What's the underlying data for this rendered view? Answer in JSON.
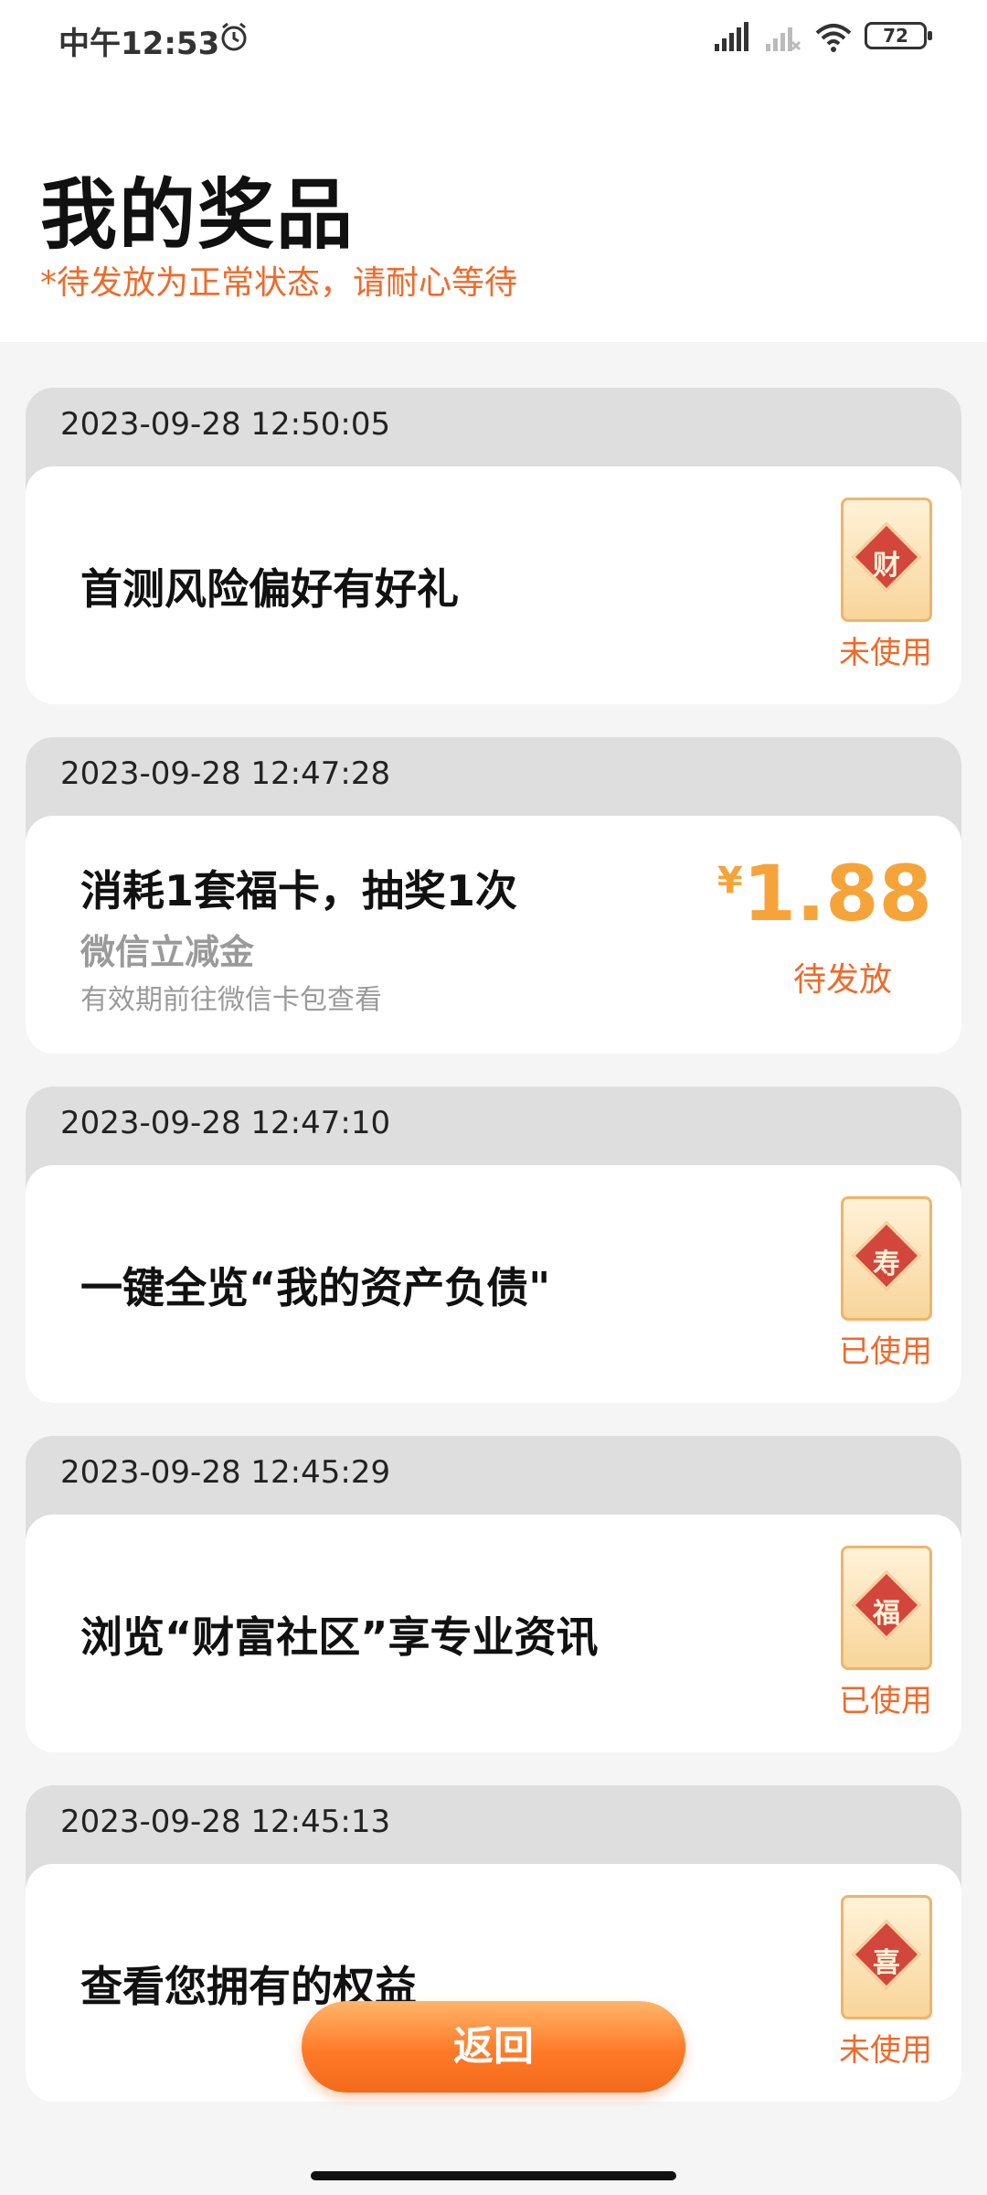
{
  "status_bar": {
    "time": "中午12:53",
    "battery": "72"
  },
  "header": {
    "title": "我的奖品",
    "subtitle": "*待发放为正常状态，请耐心等待"
  },
  "prizes": [
    {
      "time": "2023-09-28 12:50:05",
      "title": "首测风险偏好有好礼",
      "glyph": "财",
      "status": "未使用"
    },
    {
      "time": "2023-09-28 12:47:28",
      "title": "消耗1套福卡，抽奖1次",
      "subtitle": "微信立减金",
      "note": "有效期前往微信卡包查看",
      "currency": "¥",
      "amount": "1.88",
      "status": "待发放"
    },
    {
      "time": "2023-09-28 12:47:10",
      "title": "一键全览“我的资产负债\"",
      "glyph": "寿",
      "status": "已使用"
    },
    {
      "time": "2023-09-28 12:45:29",
      "title": "浏览“财富社区”享专业资讯",
      "glyph": "福",
      "status": "已使用"
    },
    {
      "time": "2023-09-28 12:45:13",
      "title": "查看您拥有的权益",
      "glyph": "喜",
      "status": "未使用"
    }
  ],
  "footer": {
    "return_label": "返回"
  }
}
